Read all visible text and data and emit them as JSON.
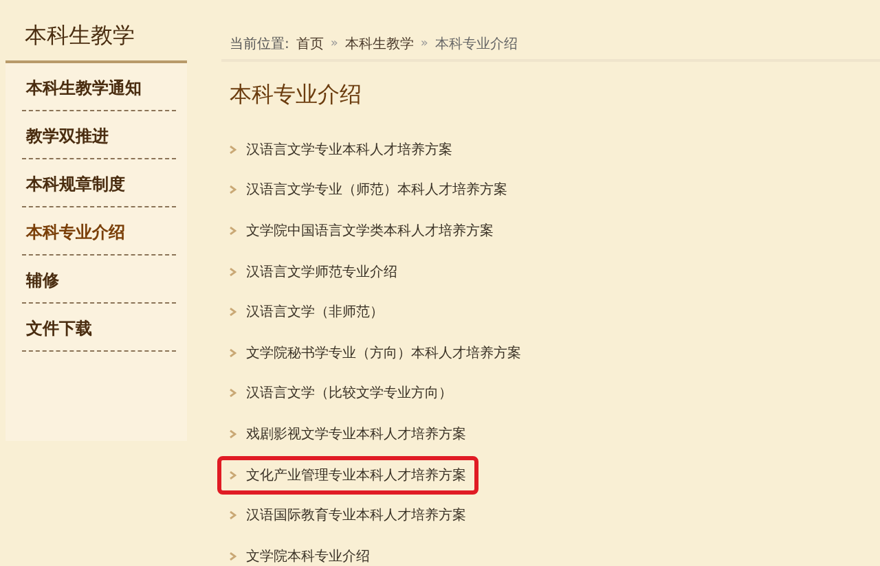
{
  "sidebar": {
    "title": "本科生教学",
    "items": [
      {
        "label": "本科生教学通知",
        "selected": false
      },
      {
        "label": "教学双推进",
        "selected": false
      },
      {
        "label": "本科规章制度",
        "selected": false
      },
      {
        "label": "本科专业介绍",
        "selected": true
      },
      {
        "label": "辅修",
        "selected": false
      },
      {
        "label": "文件下载",
        "selected": false
      }
    ]
  },
  "breadcrumb": {
    "prefix": "当前位置:",
    "items": [
      {
        "kind": "link",
        "text": "首页"
      },
      {
        "kind": "separator",
        "text": "»"
      },
      {
        "kind": "link",
        "text": "本科生教学"
      },
      {
        "kind": "separator",
        "text": "»"
      },
      {
        "kind": "current",
        "text": "本科专业介绍"
      }
    ]
  },
  "heading": "本科专业介绍",
  "articles": [
    {
      "title": "汉语言文学专业本科人才培养方案",
      "highlighted": false
    },
    {
      "title": "汉语言文学专业（师范）本科人才培养方案",
      "highlighted": false
    },
    {
      "title": "文学院中国语言文学类本科人才培养方案",
      "highlighted": false
    },
    {
      "title": "汉语言文学师范专业介绍",
      "highlighted": false
    },
    {
      "title": "汉语言文学（非师范）",
      "highlighted": false
    },
    {
      "title": "文学院秘书学专业（方向）本科人才培养方案",
      "highlighted": false
    },
    {
      "title": "汉语言文学（比较文学专业方向）",
      "highlighted": false
    },
    {
      "title": "戏剧影视文学专业本科人才培养方案",
      "highlighted": false
    },
    {
      "title": "文化产业管理专业本科人才培养方案",
      "highlighted": true
    },
    {
      "title": "汉语国际教育专业本科人才培养方案",
      "highlighted": false
    },
    {
      "title": "文学院本科专业介绍",
      "highlighted": false
    }
  ]
}
